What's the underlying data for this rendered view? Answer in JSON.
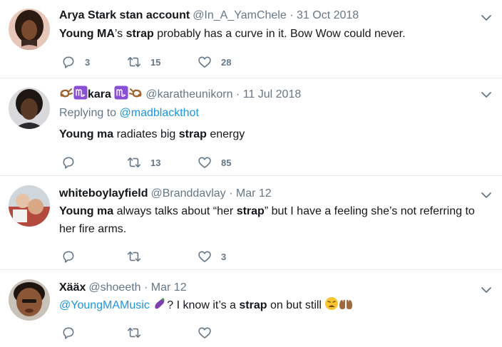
{
  "tweets": [
    {
      "name": "Arya Stark stan account",
      "handle": "@In_A_YamChele",
      "dot": "·",
      "date": "31 Oct 2018",
      "text": [
        {
          "t": "Young MA",
          "b": true
        },
        {
          "t": "’s ",
          "b": false
        },
        {
          "t": "strap",
          "b": true
        },
        {
          "t": " probably has a curve in it. Bow Wow could never.",
          "b": false
        }
      ],
      "replies": "3",
      "retweets": "15",
      "likes": "28"
    },
    {
      "name": "kara",
      "name_emoji": [
        "scorpion",
        "scorpio-sign"
      ],
      "name_emoji_after": [
        "scorpio-sign",
        "scorpion"
      ],
      "handle": "@karatheunikorn",
      "dot": "·",
      "date": "11 Jul 2018",
      "replying_label": "Replying to",
      "replying_to": "@madblackthot",
      "text": [
        {
          "t": "Young ma",
          "b": true
        },
        {
          "t": " radiates big ",
          "b": false
        },
        {
          "t": "strap",
          "b": true
        },
        {
          "t": " energy",
          "b": false
        }
      ],
      "replies": "",
      "retweets": "13",
      "likes": "85"
    },
    {
      "name": "whiteboylayfield",
      "handle": "@Branddavlay",
      "dot": "·",
      "date": "Mar 12",
      "text": [
        {
          "t": "Young ma",
          "b": true
        },
        {
          "t": " always talks about “her ",
          "b": false
        },
        {
          "t": "strap",
          "b": true
        },
        {
          "t": "” but I have a feeling she’s not referring to her fire arms.",
          "b": false
        }
      ],
      "replies": "",
      "retweets": "",
      "likes": "3"
    },
    {
      "name": "Xääx",
      "handle": "@shoeeth",
      "dot": "·",
      "date": "Mar 12",
      "text": [
        {
          "t": "@YoungMAMusic",
          "b": false,
          "mention": true
        },
        {
          "t": " ",
          "b": false
        },
        {
          "t": "EMOJI:eggplant",
          "b": false
        },
        {
          "t": "? I know it’s a ",
          "b": false
        },
        {
          "t": "strap",
          "b": true
        },
        {
          "t": " on but still ",
          "b": false
        },
        {
          "t": "EMOJI:weary-face",
          "b": false
        },
        {
          "t": "EMOJI:palms-up",
          "b": false
        }
      ],
      "replies": "",
      "retweets": "",
      "likes": ""
    }
  ],
  "icons": {
    "reply": "reply-icon",
    "retweet": "retweet-icon",
    "like": "heart-icon",
    "more": "chevron-down-icon"
  },
  "colors": {
    "name": "#14171a",
    "meta": "#657786",
    "mention": "#1b95e0",
    "divider": "#e6ecf0",
    "scorpio_purple": "#8a4fd4",
    "scorpion_brown": "#a0632c"
  }
}
